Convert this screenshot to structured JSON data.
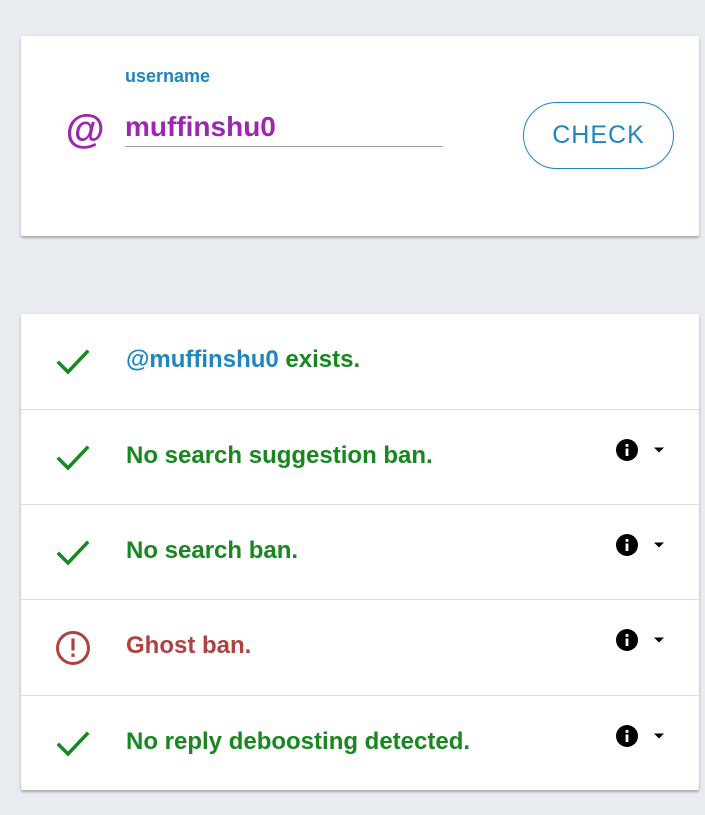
{
  "search": {
    "at_symbol": "@",
    "label": "username",
    "value": "muffinshu0",
    "button_label": "CHECK"
  },
  "results": [
    {
      "status": "ok",
      "handle": "@muffinshu0",
      "text": " exists.",
      "has_actions": false
    },
    {
      "status": "ok",
      "text": "No search suggestion ban.",
      "has_actions": true
    },
    {
      "status": "ok",
      "text": "No search ban.",
      "has_actions": true
    },
    {
      "status": "error",
      "text": "Ghost ban.",
      "has_actions": true
    },
    {
      "status": "ok",
      "text": "No reply deboosting detected.",
      "has_actions": true
    }
  ],
  "icons": {
    "ok": "check-icon",
    "error": "alert-circle-icon",
    "info": "info-icon",
    "expand": "caret-down-icon"
  },
  "colors": {
    "accent_blue": "#1e86c0",
    "username_purple": "#9c27b0",
    "success_green": "#17871f",
    "error_red": "#b24040",
    "background": "#e8ecf0"
  }
}
